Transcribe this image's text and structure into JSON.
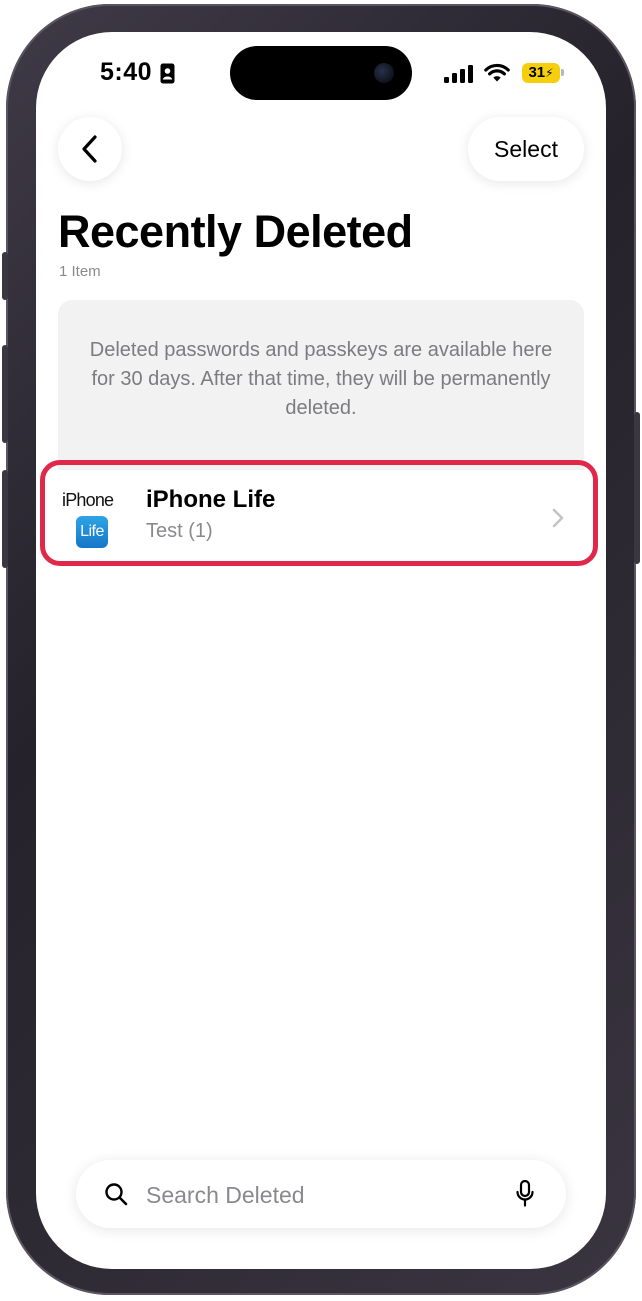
{
  "status_bar": {
    "time": "5:40",
    "battery_level": "31",
    "battery_color": "#f6cf0c"
  },
  "nav": {
    "back_icon": "chevron-left-icon",
    "select_label": "Select"
  },
  "header": {
    "title": "Recently Deleted",
    "item_count": "1 Item"
  },
  "info": {
    "message": "Deleted passwords and passkeys are available here for 30 days. After that time, they will be permanently deleted."
  },
  "items": [
    {
      "logo_word": "iPhone",
      "logo_badge": "Life",
      "title": "iPhone Life",
      "subtitle": "Test (1)"
    }
  ],
  "search": {
    "placeholder": "Search Deleted",
    "value": ""
  },
  "colors": {
    "highlight": "#e0284a",
    "logo_blue": "#1676c8"
  }
}
